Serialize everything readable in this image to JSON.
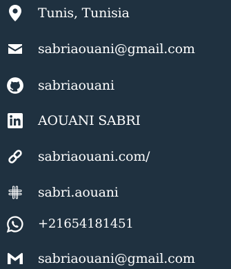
{
  "contacts": [
    {
      "id": "location",
      "icon": "map-pin-icon",
      "text": "Tunis, Tunisia"
    },
    {
      "id": "email",
      "icon": "envelope-icon",
      "text": "sabriaouani@gmail.com"
    },
    {
      "id": "github",
      "icon": "github-icon",
      "text": "sabriaouani"
    },
    {
      "id": "linkedin",
      "icon": "linkedin-icon",
      "text": "AOUANI SABRI"
    },
    {
      "id": "website",
      "icon": "link-icon",
      "text": "sabriaouani.com/"
    },
    {
      "id": "slack",
      "icon": "slack-icon",
      "text": "sabri.aouani"
    },
    {
      "id": "whatsapp",
      "icon": "whatsapp-icon",
      "text": "+21654181451"
    },
    {
      "id": "gmail",
      "icon": "gmail-icon",
      "text": "sabriaouani@gmail.com"
    }
  ],
  "colors": {
    "background": "#1f3140",
    "text": "#ffffff"
  }
}
